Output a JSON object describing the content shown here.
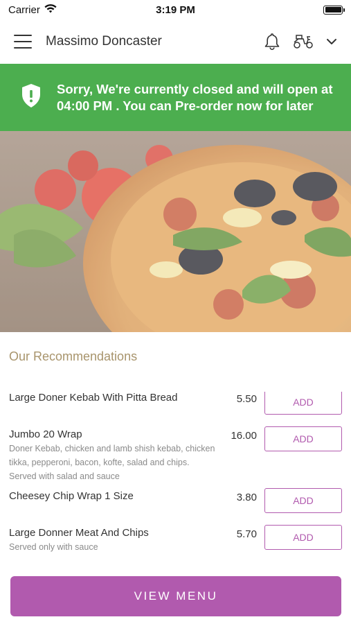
{
  "status_bar": {
    "carrier": "Carrier",
    "time": "3:19 PM"
  },
  "header": {
    "title": "Massimo Doncaster"
  },
  "banner": {
    "message": "Sorry, We're currently closed and will open at 04:00 PM . You can Pre-order now for later",
    "color": "#4cae4f"
  },
  "recommendations": {
    "title": "Our Recommendations",
    "items": [
      {
        "name": "Large Doner Kebab With Pitta Bread",
        "description": "",
        "price": "5.50",
        "add_label": "ADD"
      },
      {
        "name": "Jumbo 20 Wrap",
        "description": "Doner Kebab, chicken and lamb shish kebab, chicken tikka, pepperoni, bacon, kofte, salad and chips. Served with salad and sauce",
        "price": "16.00",
        "add_label": "ADD"
      },
      {
        "name": "Cheesey Chip Wrap 1 Size",
        "description": "",
        "price": "3.80",
        "add_label": "ADD"
      },
      {
        "name": "Large Donner Meat And Chips",
        "description": "Served only with sauce",
        "price": "5.70",
        "add_label": "ADD"
      }
    ]
  },
  "footer": {
    "view_menu_label": "VIEW MENU"
  },
  "colors": {
    "accent": "#b15aae",
    "section_title": "#a8946c"
  }
}
